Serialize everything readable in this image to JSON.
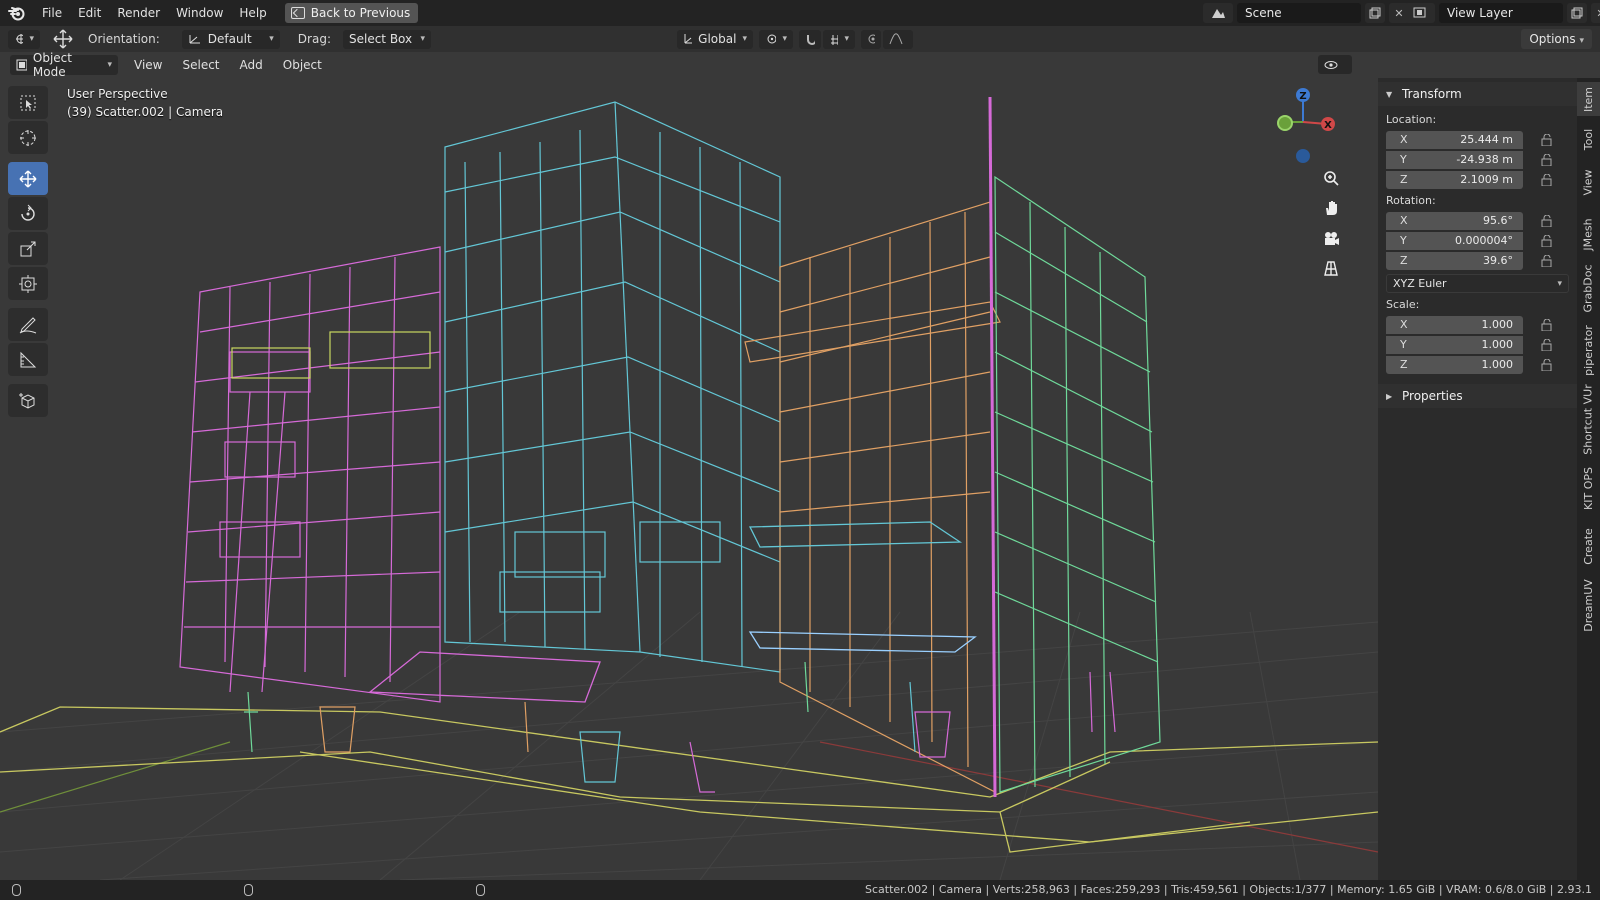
{
  "menu": {
    "items": [
      "File",
      "Edit",
      "Render",
      "Window",
      "Help"
    ],
    "back_label": "Back to Previous"
  },
  "scene": {
    "name": "Scene"
  },
  "view_layer": {
    "name": "View Layer"
  },
  "tool_header": {
    "orientation_label": "Orientation:",
    "orientation_value": "Default",
    "drag_label": "Drag:",
    "drag_value": "Select Box",
    "transform_orientation": "Global",
    "options_label": "Options"
  },
  "viewport": {
    "mode": "Object Mode",
    "menus": [
      "View",
      "Select",
      "Add",
      "Object"
    ],
    "perspective": "User Perspective",
    "object_info": "(39) Scatter.002 | Camera",
    "gizmo_axes": {
      "z": "Z",
      "x": "X"
    }
  },
  "transform_panel": {
    "title": "Transform",
    "location_label": "Location:",
    "location": [
      {
        "axis": "X",
        "value": "25.444 m"
      },
      {
        "axis": "Y",
        "value": "-24.938 m"
      },
      {
        "axis": "Z",
        "value": "2.1009 m"
      }
    ],
    "rotation_label": "Rotation:",
    "rotation": [
      {
        "axis": "X",
        "value": "95.6°"
      },
      {
        "axis": "Y",
        "value": "0.000004°"
      },
      {
        "axis": "Z",
        "value": "39.6°"
      }
    ],
    "rotation_mode": "XYZ Euler",
    "scale_label": "Scale:",
    "scale": [
      {
        "axis": "X",
        "value": "1.000"
      },
      {
        "axis": "Y",
        "value": "1.000"
      },
      {
        "axis": "Z",
        "value": "1.000"
      }
    ],
    "properties_title": "Properties"
  },
  "side_tabs": [
    "Item",
    "Tool",
    "View",
    "JMesh",
    "GrabDoc",
    "piperator",
    "Shortcut VUr",
    "KIT OPS",
    "Create",
    "DreamUV"
  ],
  "status": {
    "stats": "Scatter.002 | Camera | Verts:258,963 | Faces:259,293 | Tris:459,561 | Objects:1/377 | Memory: 1.65 GiB | VRAM: 0.6/8.0 GiB | 2.93.1"
  },
  "colors": {
    "accent": "#4772b3",
    "wire_pink": "#d66ad8",
    "wire_cyan": "#63c7d6",
    "wire_orange": "#e0a064",
    "wire_green": "#6fd99a",
    "wire_yellow": "#c8c860"
  }
}
